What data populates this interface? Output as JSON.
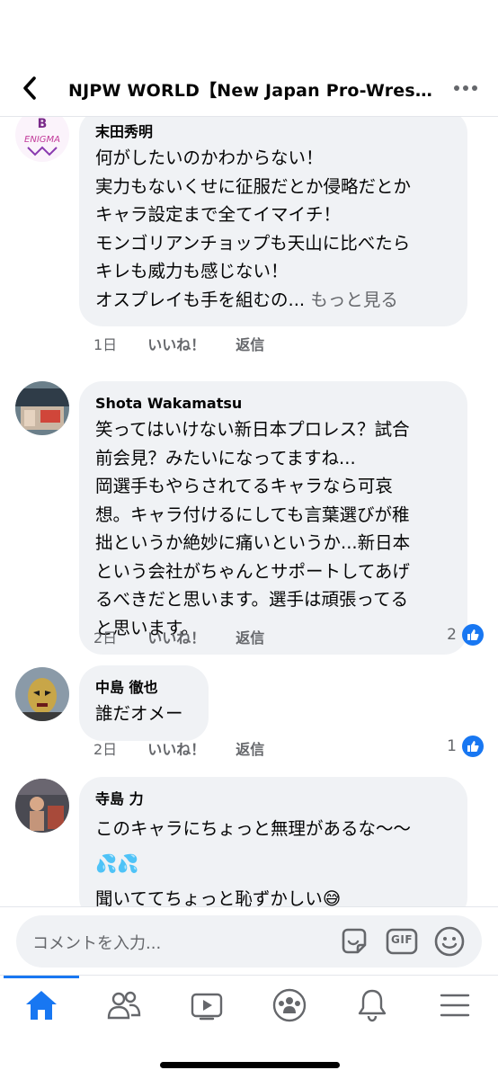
{
  "header": {
    "back_icon": "chevron-left-icon",
    "title": "NJPW WORLD【New Japan Pro-Wrestling】",
    "more_icon": "ellipsis-icon"
  },
  "comments": [
    {
      "author": "末田秀明",
      "text": "何がしたいのかわからない！\n実力もないくせに征服だとか侵略だとか\nキャラ設定まで全てイマイチ！\nモンゴリアンチョップも天山に比べたら\nキレも威力も感じない！\nオスプレイも手を組むの...",
      "see_more": "もっと見る",
      "time": "1日",
      "like_label": "いいね！",
      "reply_label": "返信",
      "reaction_count": ""
    },
    {
      "author": "Shota  Wakamatsu",
      "text": "笑ってはいけない新日本プロレス？試合\n前会見？みたいになってますね...\n岡選手もやらされてるキャラなら可哀\n想。キャラ付けるにしても言葉選びが稚\n拙というか絶妙に痛いというか...新日本\nという会社がちゃんとサポートしてあげ\nるべきだと思います。選手は頑張ってる\nと思います。",
      "time": "2日",
      "like_label": "いいね！",
      "reply_label": "返信",
      "reaction_count": "2"
    },
    {
      "author": "中島 徹也",
      "text": "誰だオメー",
      "time": "2日",
      "like_label": "いいね！",
      "reply_label": "返信",
      "reaction_count": "1"
    },
    {
      "author": "寺島 力",
      "text": "このキャラにちょっと無理があるな〜〜\n💦💦\n聞いててちょっと恥ずかしい😅",
      "time": "",
      "like_label": "",
      "reply_label": "",
      "reaction_count": ""
    }
  ],
  "composer": {
    "placeholder": "コメントを入力...",
    "sticker_icon": "sticker-icon",
    "gif_label": "GIF",
    "emoji_icon": "emoji-icon"
  },
  "tabbar": {
    "items": [
      "home-icon",
      "friends-icon",
      "watch-icon",
      "groups-icon",
      "notifications-icon",
      "menu-icon"
    ],
    "active": "home-icon"
  },
  "colors": {
    "accent": "#1877f2",
    "bubble": "#f0f2f5",
    "secondary_text": "#65676b"
  }
}
